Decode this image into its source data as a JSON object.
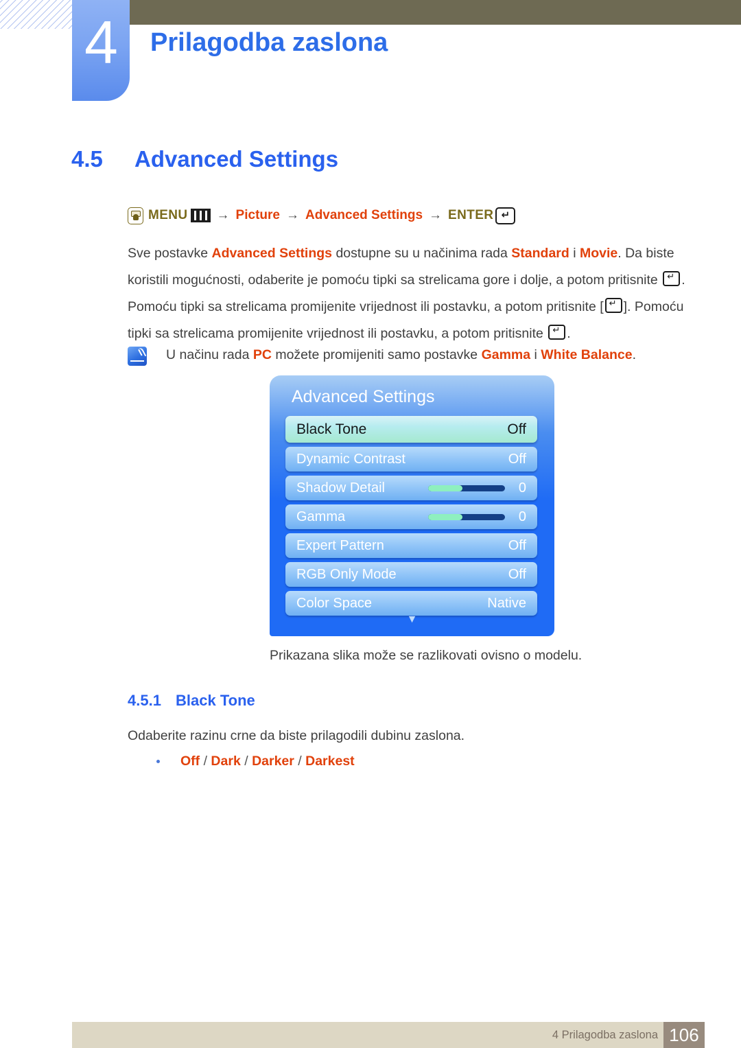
{
  "header": {
    "chapter_number": "4",
    "chapter_title": "Prilagodba zaslona"
  },
  "section": {
    "number": "4.5",
    "title": "Advanced Settings"
  },
  "menu_path": {
    "hand_icon": "hand-press-icon",
    "menu_label": "MENU",
    "menu_bars_icon": "menu-bars-icon",
    "arrow1": "→",
    "picture_label": "Picture",
    "arrow2": "→",
    "advanced_settings_label": "Advanced Settings",
    "arrow3": "→",
    "enter_label": "ENTER",
    "enter_icon": "enter-return-icon"
  },
  "body": {
    "p1_a": "Sve postavke ",
    "p1_hl1": "Advanced Settings",
    "p1_b": " dostupne su u načinima rada ",
    "p1_hl2": "Standard",
    "p1_c": " i ",
    "p1_hl3": "Movie",
    "p1_d": ". Da biste koristili mogućnosti, odaberite je pomoću tipki sa strelicama gore i dolje, a potom pritisnite ",
    "p1_e": ". Pomoću tipki sa strelicama promijenite vrijednost ili postavku, a potom pritisnite [",
    "p1_f": "]. Pomoću tipki sa strelicama promijenite vrijednost ili postavku, a potom pritisnite ",
    "p1_g": "."
  },
  "note": {
    "icon": "note-quill-icon",
    "a": "U načinu rada ",
    "hl1": "PC",
    "b": " možete promijeniti samo postavke ",
    "hl2": "Gamma",
    "c": " i ",
    "hl3": "White Balance",
    "d": "."
  },
  "osd": {
    "title": "Advanced Settings",
    "scroll_down_icon": "▼",
    "rows": [
      {
        "label": "Black Tone",
        "value": "Off",
        "type": "value",
        "selected": true
      },
      {
        "label": "Dynamic Contrast",
        "value": "Off",
        "type": "value",
        "selected": false
      },
      {
        "label": "Shadow Detail",
        "value": "0",
        "type": "slider",
        "fill_pct": 45,
        "selected": false
      },
      {
        "label": "Gamma",
        "value": "0",
        "type": "slider",
        "fill_pct": 45,
        "selected": false
      },
      {
        "label": "Expert Pattern",
        "value": "Off",
        "type": "value",
        "selected": false
      },
      {
        "label": "RGB Only Mode",
        "value": "Off",
        "type": "value",
        "selected": false
      },
      {
        "label": "Color Space",
        "value": "Native",
        "type": "value",
        "selected": false
      }
    ]
  },
  "caption": "Prikazana slika može se razlikovati ovisno o modelu.",
  "subsection": {
    "number": "4.5.1",
    "title": "Black Tone",
    "paragraph": "Odaberite razinu crne da biste prilagodili dubinu zaslona.",
    "bullet": {
      "o1": "Off",
      "sep1": " / ",
      "o2": "Dark",
      "sep2": " / ",
      "o3": "Darker",
      "sep3": " / ",
      "o4": "Darkest"
    }
  },
  "footer": {
    "label": "4 Prilagodba zaslona",
    "page": "106"
  },
  "colors": {
    "accent_blue": "#2a61ee",
    "highlight_orange": "#e1410b",
    "olive_text": "#7a6a1c",
    "olive_bar": "#6e6a53",
    "footer_bg": "#ddd7c4",
    "footer_page_bg": "#988b7e",
    "osd_blue": "#1f6bf5",
    "osd_selected": "#a5e9cf"
  }
}
